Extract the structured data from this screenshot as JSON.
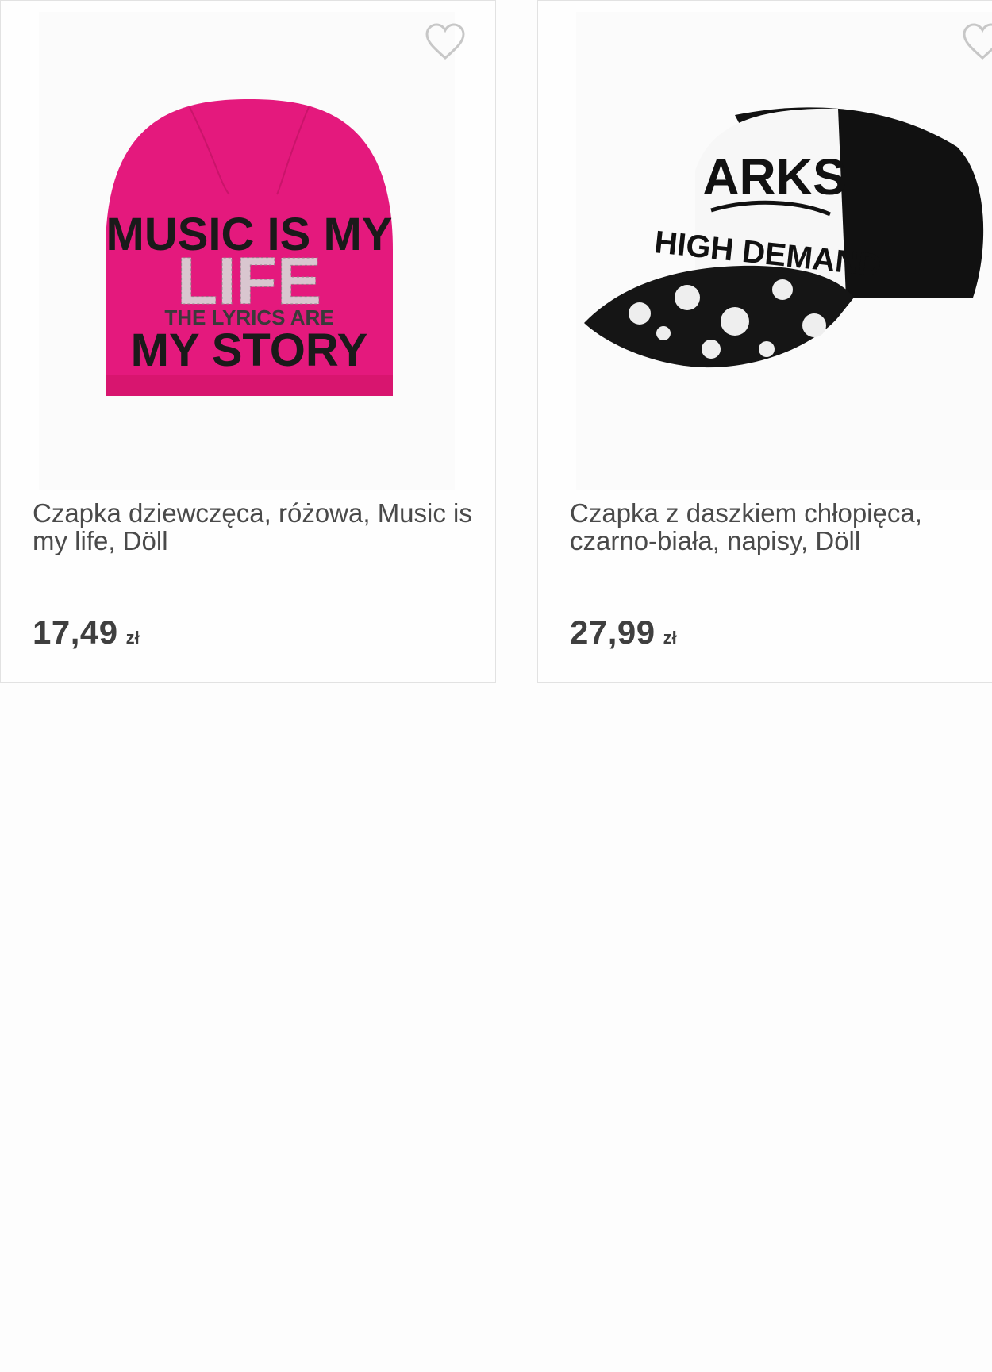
{
  "products": [
    {
      "title": "Czapka dziewczęca, różowa, Music is my life, Döll",
      "price": "17,49",
      "currency": "zł",
      "image_print": {
        "line1": "MUSIC IS MY",
        "line2": "LIFE",
        "line3": "THE LYRICS ARE",
        "line4": "MY STORY"
      }
    },
    {
      "title": "Czapka z daszkiem chłopięca, czarno-biała, napisy, Döll",
      "price": "27,99",
      "currency": "zł",
      "image_print": {
        "line1": "ARKS",
        "line2": "HIGH DEMAND"
      }
    }
  ],
  "colors": {
    "beanie_pink": "#e4197d",
    "text": "#4a4a4a",
    "border": "#e2e2e2"
  }
}
